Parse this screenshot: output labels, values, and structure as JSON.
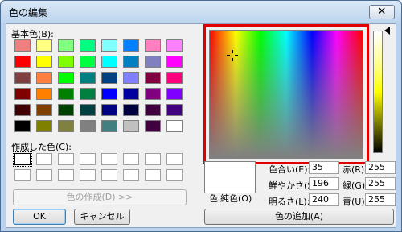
{
  "dialog": {
    "title": "色の編集",
    "close_icon": "close-icon"
  },
  "basic": {
    "label": "基本色(B):",
    "colors": [
      "#f08080",
      "#ffff80",
      "#80ff80",
      "#00ff80",
      "#80ffff",
      "#0080ff",
      "#ff80c0",
      "#ff80ff",
      "#ff0000",
      "#ffff00",
      "#80ff00",
      "#00ff40",
      "#00ffff",
      "#0080c0",
      "#8080c0",
      "#ff00ff",
      "#804040",
      "#ff8040",
      "#00ff00",
      "#008080",
      "#004080",
      "#8080ff",
      "#800040",
      "#ff0080",
      "#800000",
      "#ff8000",
      "#008000",
      "#008040",
      "#0000ff",
      "#0000a0",
      "#800080",
      "#8000ff",
      "#400000",
      "#804000",
      "#004000",
      "#004040",
      "#000080",
      "#000040",
      "#400040",
      "#400080",
      "#000000",
      "#808000",
      "#808040",
      "#808080",
      "#408080",
      "#c0c0c0",
      "#400040",
      "#ffffff"
    ]
  },
  "custom": {
    "label": "作成した色(C):"
  },
  "buttons": {
    "define": "色の作成(D) >>",
    "ok": "OK",
    "cancel": "キャンセル",
    "add": "色の追加(A)"
  },
  "preview": {
    "color_label": "色",
    "solid_label": "純色(O)"
  },
  "values": {
    "hue_label": "色合い(E):",
    "hue": "35",
    "sat_label": "鮮やかさ(S):",
    "sat": "196",
    "lum_label": "明るさ(L):",
    "lum": "240",
    "red_label": "赤(R):",
    "red": "255",
    "green_label": "緑(G):",
    "green": "255",
    "blue_label": "青(U):",
    "blue": "255"
  }
}
